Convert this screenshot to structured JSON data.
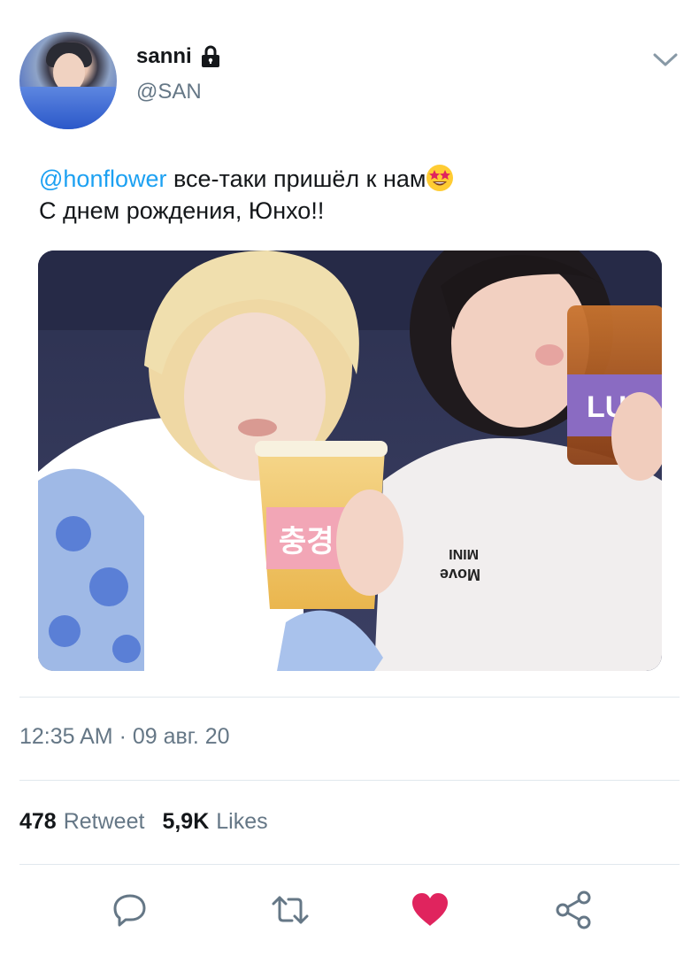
{
  "user": {
    "display_name": "sanni",
    "handle": "@SAN"
  },
  "tweet": {
    "mention": "@honflower",
    "line1_text": " все-таки пришёл к нам",
    "line2_text": "С днем рождения, Юнхо!!",
    "emoji": "star-struck-emoji-icon"
  },
  "timestamp": "12:35 AM · 09 авг. 20",
  "stats": {
    "retweets_count": "478",
    "retweets_label": "Retweet",
    "likes_count": "5,9K",
    "likes_label": "Likes"
  },
  "actions": [
    "reply-icon",
    "retweet-icon",
    "like-icon",
    "share-icon"
  ],
  "colors": {
    "accent": "#1da1f2",
    "like": "#e0245e",
    "secondary_text": "#657786",
    "divider": "#e1e8ed"
  },
  "media": {
    "cup_label_left": "충경",
    "cup_label_right": "LUL",
    "shirt_text_top": "Move",
    "shirt_text_bottom": "MINI"
  }
}
